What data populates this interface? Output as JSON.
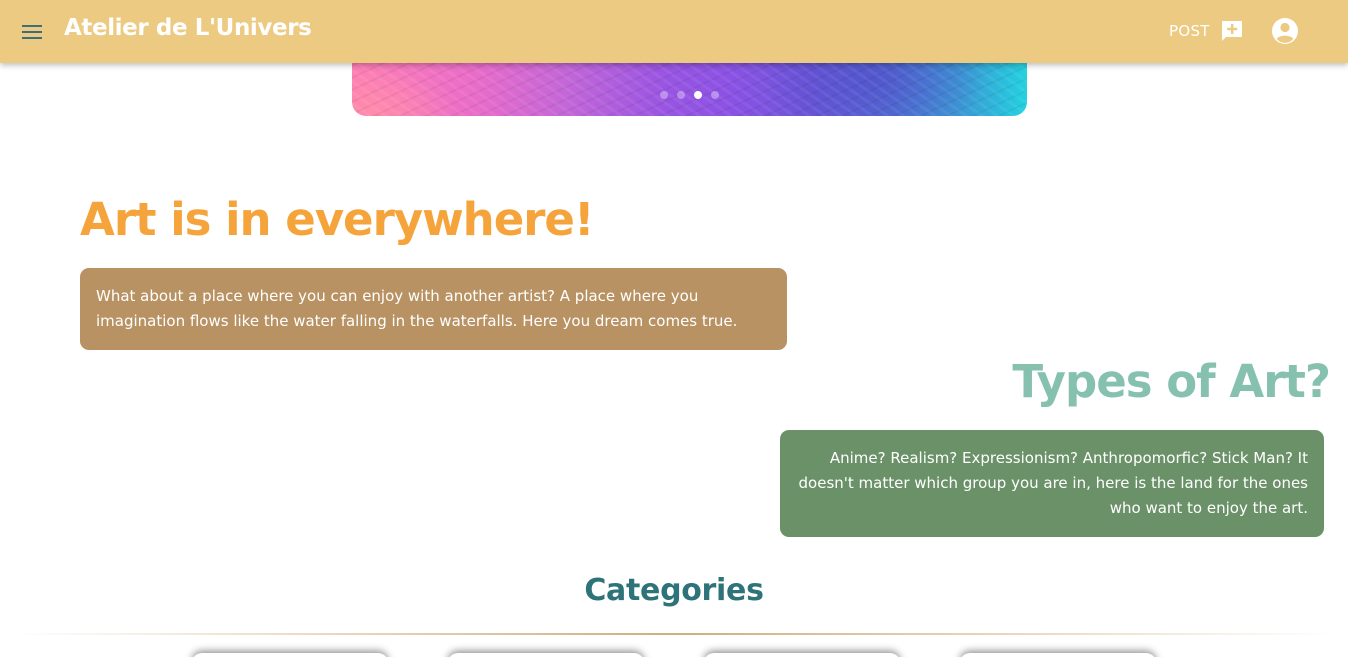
{
  "app": {
    "title": "Atelier de L'Univers",
    "brand_color": "#ecca82"
  },
  "header": {
    "menu_icon": "hamburger-menu-icon",
    "post_label": "POST",
    "post_icon": "add-comment-icon",
    "account_icon": "account-circle-icon"
  },
  "carousel": {
    "slide_count": 4,
    "active_index": 2
  },
  "hero": {
    "heading": "Art is in everywhere!",
    "heading_color": "#f5a43c",
    "text": "What about a place where you can enjoy with another artist? A place where you imagination flows like the water falling in the waterfalls. Here you dream comes true.",
    "box_color": "#b89262"
  },
  "types": {
    "heading": "Types of Art?",
    "heading_color": "#86c1b0",
    "text": "Anime? Realism? Expressionism? Anthropomorfic? Stick Man? It doesn't matter which group you are in, here is the land for the ones who want to enjoy the art.",
    "box_color": "#6b9169"
  },
  "categories": {
    "heading": "Categories",
    "heading_color": "#2e7379",
    "card_count": 4
  }
}
